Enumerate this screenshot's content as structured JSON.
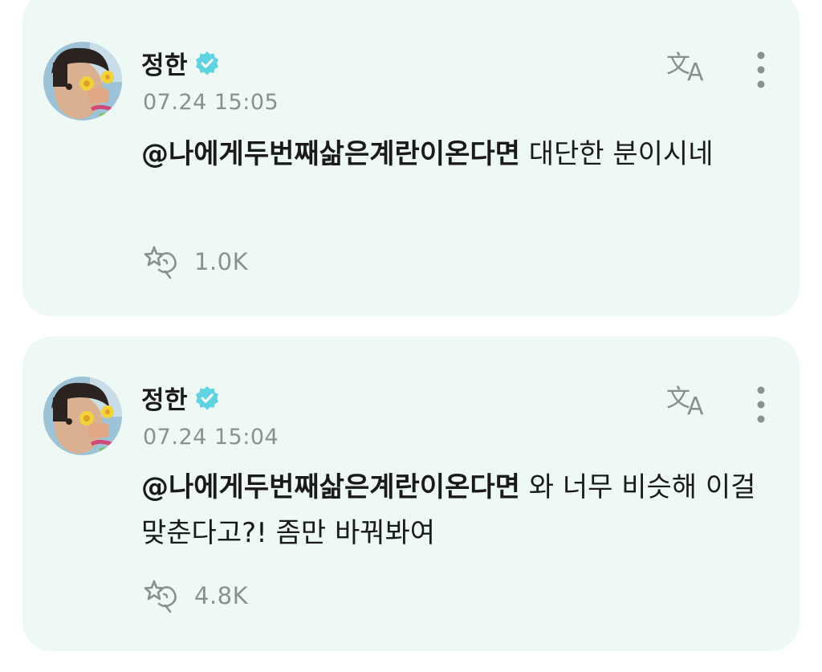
{
  "posts": [
    {
      "author": "정한",
      "timestamp": "07.24 15:05",
      "mention": "@나에게두번째삶은계란이온다면",
      "text": " 대단한 분이시네",
      "reaction_count": "1.0K",
      "avatar_icon": "profile-photo",
      "verified_icon": "verified-badge-icon",
      "translate_icon": "translate-icon",
      "more_icon": "more-vertical-icon",
      "reaction_icon": "reaction-icon"
    },
    {
      "author": "정한",
      "timestamp": "07.24 15:04",
      "mention": "@나에게두번째삶은계란이온다면",
      "text": " 와 너무 비슷해 이걸 맞춘다고?! 좀만 바꿔봐여",
      "reaction_count": "4.8K",
      "avatar_icon": "profile-photo",
      "verified_icon": "verified-badge-icon",
      "translate_icon": "translate-icon",
      "more_icon": "more-vertical-icon",
      "reaction_icon": "reaction-icon"
    }
  ],
  "colors": {
    "card_background": "#eef9f6",
    "verified_badge": "#5fd3df",
    "icon_gray": "#8a8f92",
    "text": "#1a1a1a"
  }
}
